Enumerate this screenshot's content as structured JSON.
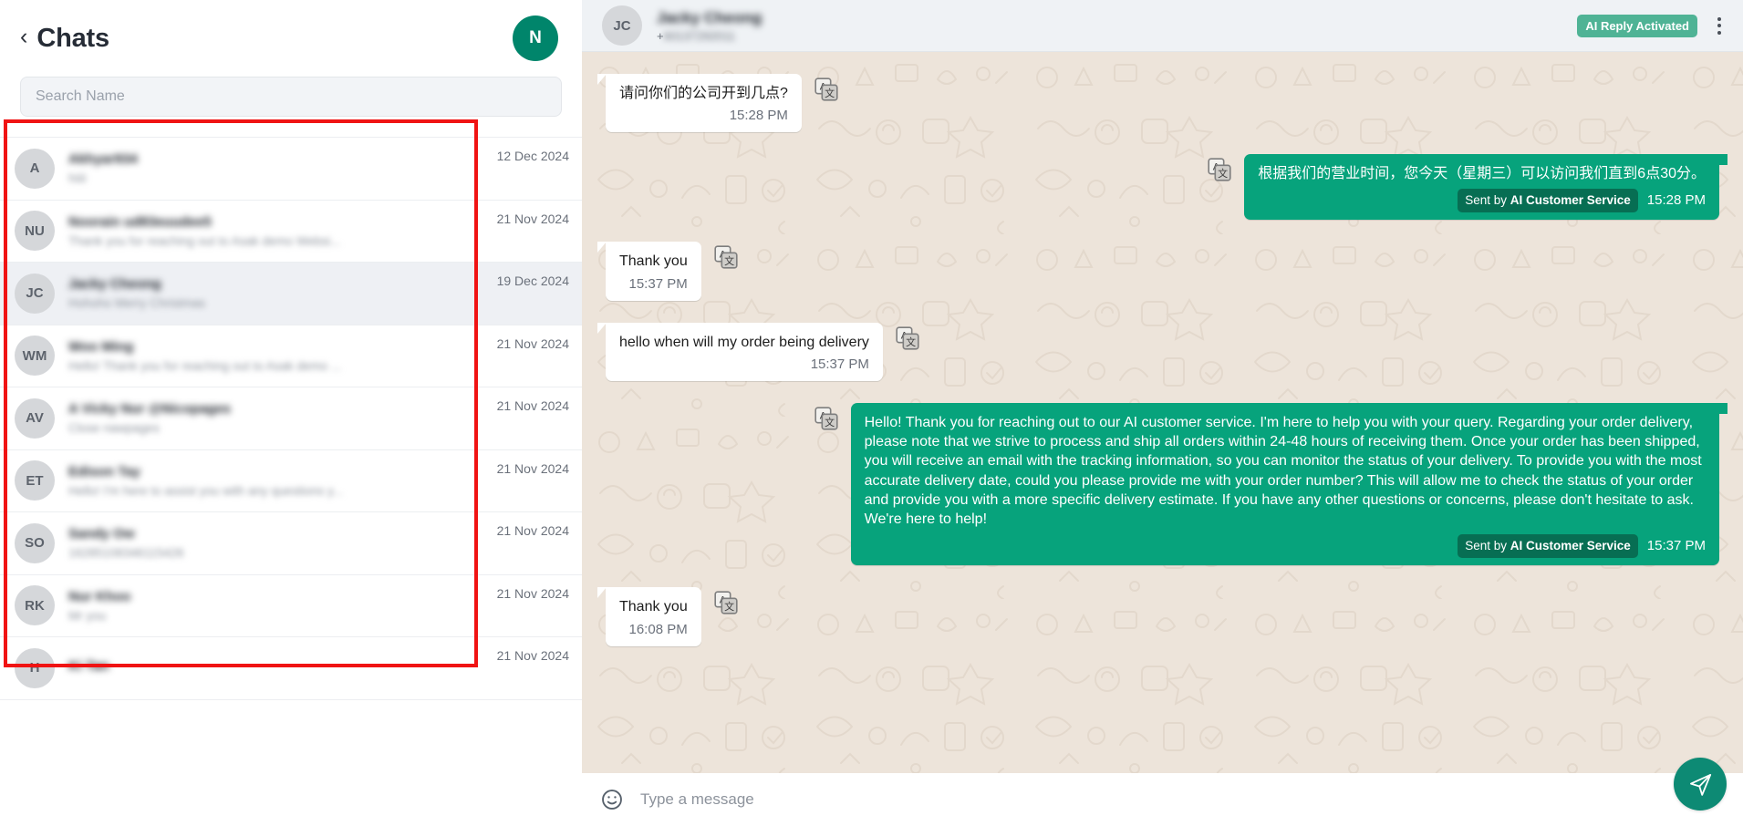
{
  "sidebar": {
    "back_icon": "chevron-left-icon",
    "title": "Chats",
    "profile_initial": "N",
    "search": {
      "placeholder": "Search Name",
      "value": ""
    },
    "chats": [
      {
        "initials": "A",
        "name": "Akhyar934",
        "preview": "hiiii",
        "date": "12 Dec 2024",
        "active": false
      },
      {
        "initials": "NU",
        "name": "Noorain ud83euudee5",
        "preview": "Thank you for reaching out to Asak demo Websi...",
        "date": "21 Nov 2024",
        "active": false
      },
      {
        "initials": "JC",
        "name": "Jacky Cheong",
        "preview": "Hohoho Merry Christmas",
        "date": "19 Dec 2024",
        "active": true
      },
      {
        "initials": "WM",
        "name": "Woo Ming",
        "preview": "Hello! Thank you for reaching out to Asak demo ...",
        "date": "21 Nov 2024",
        "active": false
      },
      {
        "initials": "AV",
        "name": "A Vicky Nur @Nicopages",
        "preview": "Close nawpages",
        "date": "21 Nov 2024",
        "active": false
      },
      {
        "initials": "ET",
        "name": "Edison Tay",
        "preview": "Hello! I'm here to assist you with any questions y...",
        "date": "21 Nov 2024",
        "active": false
      },
      {
        "initials": "SO",
        "name": "Sandy Ow",
        "preview": "16285108346115426",
        "date": "21 Nov 2024",
        "active": false
      },
      {
        "initials": "RK",
        "name": "Nur Khoo",
        "preview": "Mr you",
        "date": "21 Nov 2024",
        "active": false
      },
      {
        "initials": "H",
        "name": "Ki Tan",
        "preview": "",
        "date": "21 Nov 2024",
        "active": false
      }
    ]
  },
  "chat_header": {
    "avatar_initials": "JC",
    "contact_name": "Jacky Cheong",
    "phone_prefix": "+",
    "phone_number": "60137292011",
    "ai_badge": "AI Reply Activated",
    "menu_icon": "kebab-menu-icon"
  },
  "messages": [
    {
      "direction": "in",
      "text": "请问你们的公司开到几点?",
      "time": "15:28 PM",
      "translate_icon": "translate-icon"
    },
    {
      "direction": "out",
      "text": "根据我们的营业时间，您今天（星期三）可以访问我们直到6点30分。",
      "time": "15:28 PM",
      "sent_by_prefix": "Sent by ",
      "sent_by_name": "AI Customer Service",
      "translate_icon": "translate-icon"
    },
    {
      "direction": "in",
      "text": "Thank you",
      "time": "15:37 PM",
      "translate_icon": "translate-icon"
    },
    {
      "direction": "in",
      "text": "hello when will my order being delivery",
      "time": "15:37 PM",
      "translate_icon": "translate-icon"
    },
    {
      "direction": "out",
      "text": "Hello! Thank you for reaching out to our AI customer service. I'm here to help you with your query. Regarding your order delivery, please note that we strive to process and ship all orders within 24-48 hours of receiving them. Once your order has been shipped, you will receive an email with the tracking information, so you can monitor the status of your delivery. To provide you with the most accurate delivery date, could you please provide me with your order number? This will allow me to check the status of your order and provide you with a more specific delivery estimate. If you have any other questions or concerns, please don't hesitate to ask. We're here to help!",
      "time": "15:37 PM",
      "sent_by_prefix": "Sent by ",
      "sent_by_name": "AI Customer Service",
      "translate_icon": "translate-icon"
    },
    {
      "direction": "in",
      "text": "Thank you",
      "time": "16:08 PM",
      "translate_icon": "translate-icon"
    }
  ],
  "composer": {
    "emoji_icon": "emoji-smiley-icon",
    "placeholder": "Type a message",
    "value": "",
    "send_icon": "send-paper-plane-icon"
  },
  "colors": {
    "brand_green": "#07a37c",
    "profile_green": "#00856b",
    "badge_green": "#4fb395",
    "sent_by_green": "#076e53",
    "send_button": "#0d8a74",
    "annotation_red": "#f01313",
    "chat_bg": "#ede4da",
    "active_row": "#eef0f4"
  }
}
